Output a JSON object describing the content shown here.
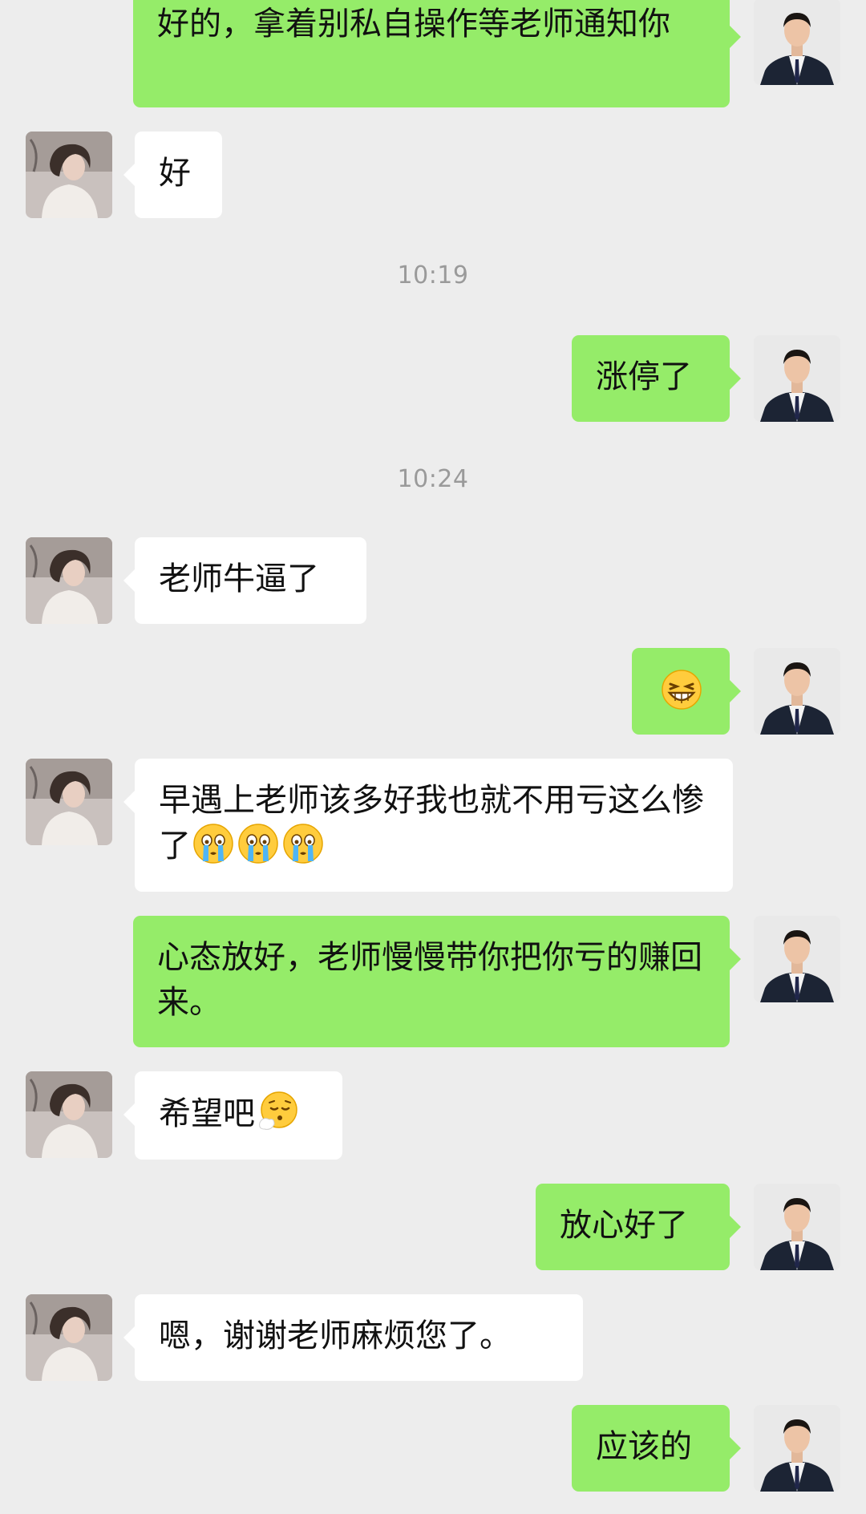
{
  "timestamps": [
    "10:19",
    "10:24"
  ],
  "icons": {
    "laugh": "grinning-squint-face-icon",
    "cry": "loudly-crying-face-icon",
    "sigh": "face-exhaling-icon"
  },
  "colors": {
    "background": "#ededed",
    "outgoing_bubble": "#95ec69",
    "incoming_bubble": "#ffffff"
  },
  "messages": [
    {
      "side": "out",
      "text": "好的，拿着别私自操作等老师通知你"
    },
    {
      "side": "in",
      "text": "好"
    },
    {
      "side": "out",
      "text": "涨停了"
    },
    {
      "side": "in",
      "text": "老师牛逼了"
    },
    {
      "side": "out",
      "text": "",
      "emoji": "grinning-squint-face-icon"
    },
    {
      "side": "in",
      "text": "早遇上老师该多好我也就不用亏这么惨了",
      "emoji_count": 3
    },
    {
      "side": "out",
      "text": "心态放好，老师慢慢带你把你亏的赚回来。"
    },
    {
      "side": "in",
      "text": "希望吧"
    },
    {
      "side": "out",
      "text": "放心好了"
    },
    {
      "side": "in",
      "text": "嗯，谢谢老师麻烦您了。"
    },
    {
      "side": "out",
      "text": "应该的"
    }
  ]
}
